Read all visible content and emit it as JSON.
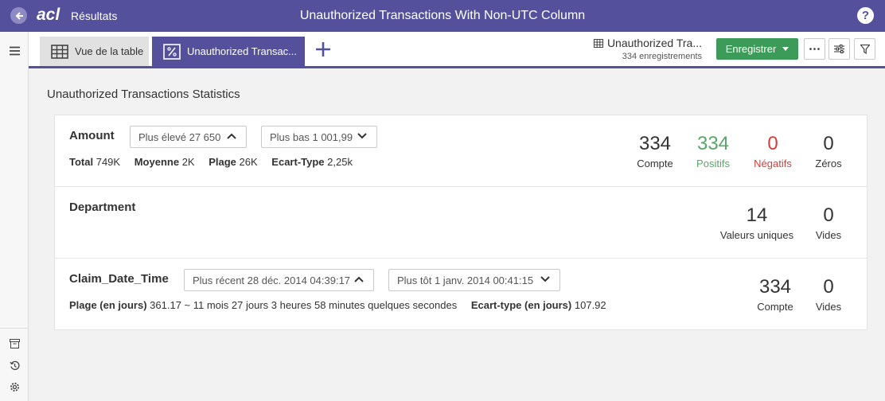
{
  "header": {
    "breadcrumb": "Résultats",
    "title": "Unauthorized Transactions With Non-UTC Column",
    "help_label": "?",
    "accent_color": "#54509b"
  },
  "tabs": [
    {
      "label": "Vue de la table",
      "icon": "table-icon",
      "active": false
    },
    {
      "label": "Unauthorized Transac...",
      "icon": "percent-icon",
      "active": true
    }
  ],
  "dataset": {
    "name": "Unauthorized Tra...",
    "record_count": "334 enregistrements"
  },
  "toolbar": {
    "save_label": "Enregistrer",
    "save_color": "#3d9b59"
  },
  "main": {
    "section_title": "Unauthorized Transactions Statistics",
    "columns": [
      {
        "name": "Amount",
        "dropdown_high": "Plus élevé 27 650",
        "dropdown_low": "Plus bas 1 001,99",
        "stats": [
          {
            "label": "Total",
            "value": "749K"
          },
          {
            "label": "Moyenne",
            "value": "2K"
          },
          {
            "label": "Plage",
            "value": "26K"
          },
          {
            "label": "Ecart-Type",
            "value": "2,25k"
          }
        ],
        "metrics": [
          {
            "value": "334",
            "label": "Compte"
          },
          {
            "value": "334",
            "label": "Positifs"
          },
          {
            "value": "0",
            "label": "Négatifs"
          },
          {
            "value": "0",
            "label": "Zéros"
          }
        ]
      },
      {
        "name": "Department",
        "metrics": [
          {
            "value": "14",
            "label": "Valeurs uniques"
          },
          {
            "value": "0",
            "label": "Vides"
          }
        ]
      },
      {
        "name": "Claim_Date_Time",
        "dropdown_high": "Plus récent 28 déc. 2014 04:39:17",
        "dropdown_low": "Plus tôt 1 janv. 2014 00:41:15",
        "stats": [
          {
            "label": "Plage (en jours)",
            "value": "361.17 ~ 11 mois 27 jours 3 heures 58 minutes quelques secondes"
          },
          {
            "label": "Ecart-type (en jours)",
            "value": "107.92"
          }
        ],
        "metrics": [
          {
            "value": "334",
            "label": "Compte"
          },
          {
            "value": "0",
            "label": "Vides"
          }
        ]
      }
    ]
  },
  "colors": {
    "positive": "#5aa56a",
    "negative": "#d0413c"
  }
}
